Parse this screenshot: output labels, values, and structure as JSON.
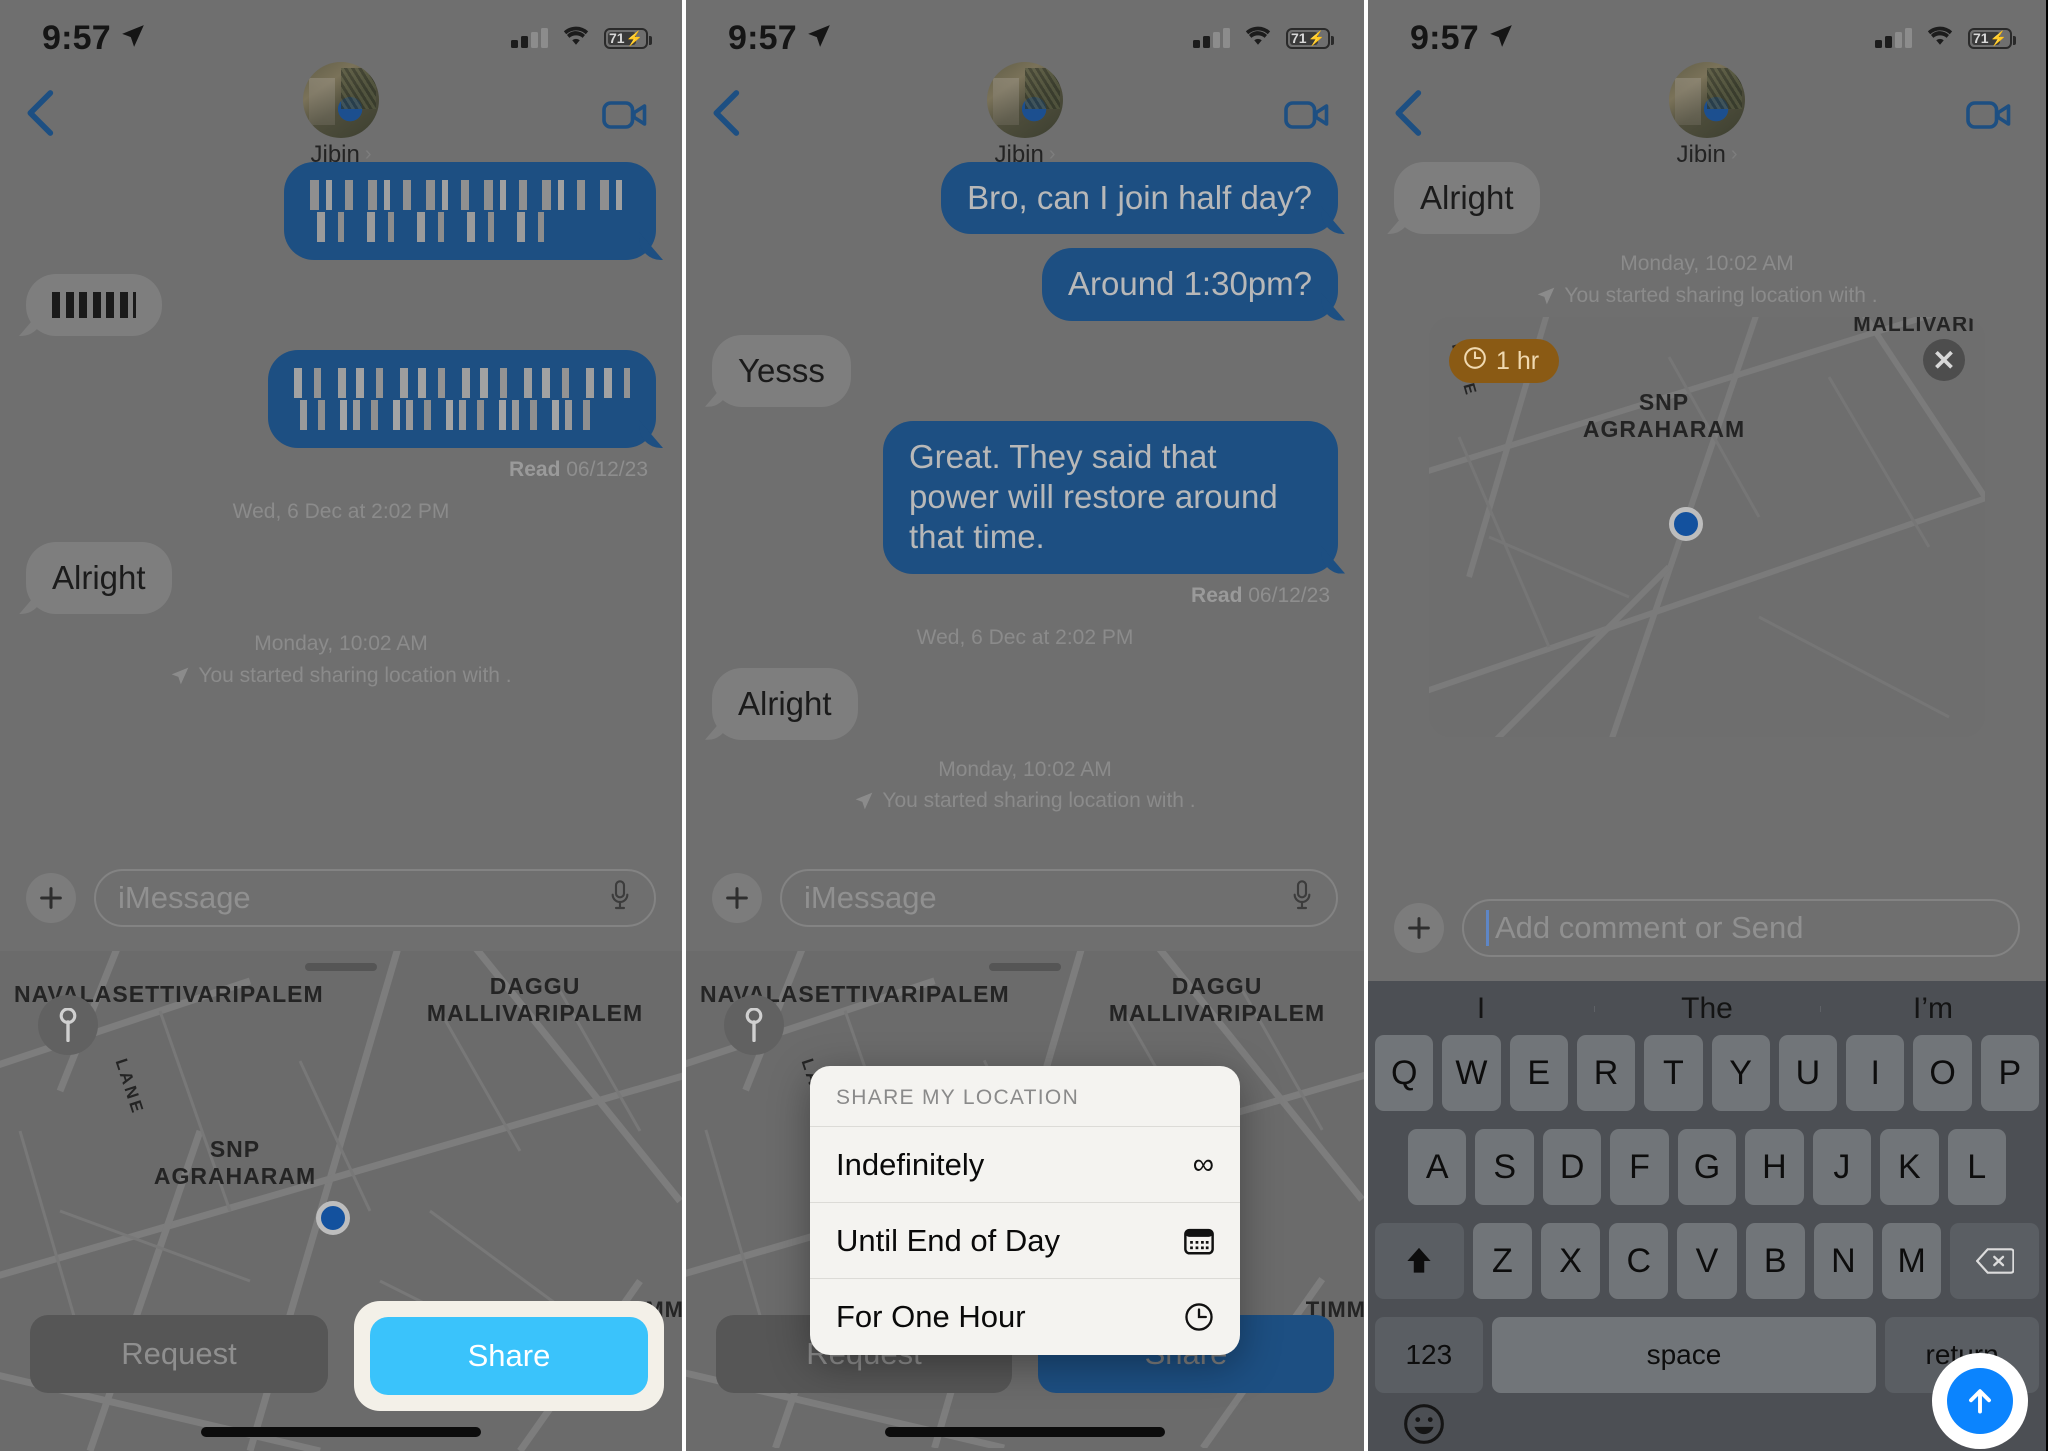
{
  "status_bar": {
    "time": "9:57",
    "battery_level": "71",
    "location_arrow_icon": "location-arrow-icon",
    "signal_icon": "cellular-signal-icon",
    "wifi_icon": "wifi-icon",
    "battery_icon": "battery-charging-icon"
  },
  "nav": {
    "back_icon": "chevron-left-icon",
    "contact_name": "Jibin",
    "disclosure_icon": "chevron-right-icon",
    "facetime_icon": "video-camera-icon",
    "avatar_icon": "contact-avatar"
  },
  "panel1": {
    "messages": [
      {
        "side": "out",
        "censored": true,
        "lines": 2
      },
      {
        "side": "in",
        "censored": true,
        "lines": 1
      },
      {
        "side": "out",
        "censored": true,
        "lines": 2
      }
    ],
    "read_prefix": "Read",
    "read_date": "06/12/23",
    "daystamp": "Wed, 6 Dec at 2:02 PM",
    "reply": "Alright",
    "loc_time": "Monday, 10:02 AM",
    "loc_text": "You started sharing location with .",
    "input_placeholder": "iMessage",
    "plus_icon": "plus-icon",
    "mic_icon": "microphone-icon",
    "map": {
      "labels": [
        {
          "text": "NAVALASETTIVARIPALEM"
        },
        {
          "text": "DAGGU\nMALLIVARIPALEM"
        },
        {
          "text": "SNP\nAGRAHARAM"
        },
        {
          "text": "LANE"
        },
        {
          "text": "TIMM"
        }
      ],
      "request_label": "Request",
      "share_label": "Share",
      "locate_icon": "locate-me-icon",
      "user_dot_icon": "current-location-dot"
    }
  },
  "panel2": {
    "messages": [
      {
        "side": "out",
        "text": "Bro, can I join half day?"
      },
      {
        "side": "out",
        "text": "Around 1:30pm?",
        "underline": "1:30pm"
      },
      {
        "side": "in",
        "text": "Yesss"
      },
      {
        "side": "out",
        "text": "Great. They said that power will restore around that time."
      }
    ],
    "read_prefix": "Read",
    "read_date": "06/12/23",
    "daystamp": "Wed, 6 Dec at 2:02 PM",
    "reply": "Alright",
    "loc_time": "Monday, 10:02 AM",
    "loc_text": "You started sharing location with .",
    "input_placeholder": "iMessage",
    "action_sheet": {
      "header": "SHARE MY LOCATION",
      "items": [
        {
          "label": "Indefinitely",
          "icon": "infinity-icon",
          "glyph": "∞"
        },
        {
          "label": "Until End of Day",
          "icon": "calendar-icon",
          "glyph": "calendar"
        },
        {
          "label": "For One Hour",
          "icon": "clock-icon",
          "glyph": "clock"
        }
      ]
    },
    "map": {
      "request_label": "Request",
      "share_label": "Share"
    }
  },
  "panel3": {
    "reply": "Alright",
    "loc_time": "Monday, 10:02 AM",
    "loc_text": "You started sharing location with .",
    "map_card": {
      "duration_badge": "1 hr",
      "badge_icon": "clock-icon",
      "close_icon": "close-x-icon",
      "labels": [
        {
          "text": "SNP\nAGRAHARAM"
        },
        {
          "text": "MALLIVARI"
        },
        {
          "text": "LANE"
        }
      ]
    },
    "input_placeholder": "Add comment or Send",
    "send_icon": "send-arrow-up-icon",
    "keyboard": {
      "predictions": [
        "I",
        "The",
        "I’m"
      ],
      "row1": [
        "Q",
        "W",
        "E",
        "R",
        "T",
        "Y",
        "U",
        "I",
        "O",
        "P"
      ],
      "row2": [
        "A",
        "S",
        "D",
        "F",
        "G",
        "H",
        "J",
        "K",
        "L"
      ],
      "row3": [
        "Z",
        "X",
        "C",
        "V",
        "B",
        "N",
        "M"
      ],
      "shift_icon": "shift-up-icon",
      "backspace_icon": "backspace-icon",
      "numbers_label": "123",
      "space_label": "space",
      "return_label": "return",
      "emoji_icon": "emoji-smiley-icon",
      "dictate_icon": "microphone-icon"
    }
  },
  "colors": {
    "bubble_out": "#1d4f82",
    "bubble_in": "#7e7e7e",
    "share_active": "#3ac3fb",
    "send_blue": "#0b84fe",
    "badge_orange": "#8a5a14",
    "highlight_cream": "#f3f0e8"
  }
}
